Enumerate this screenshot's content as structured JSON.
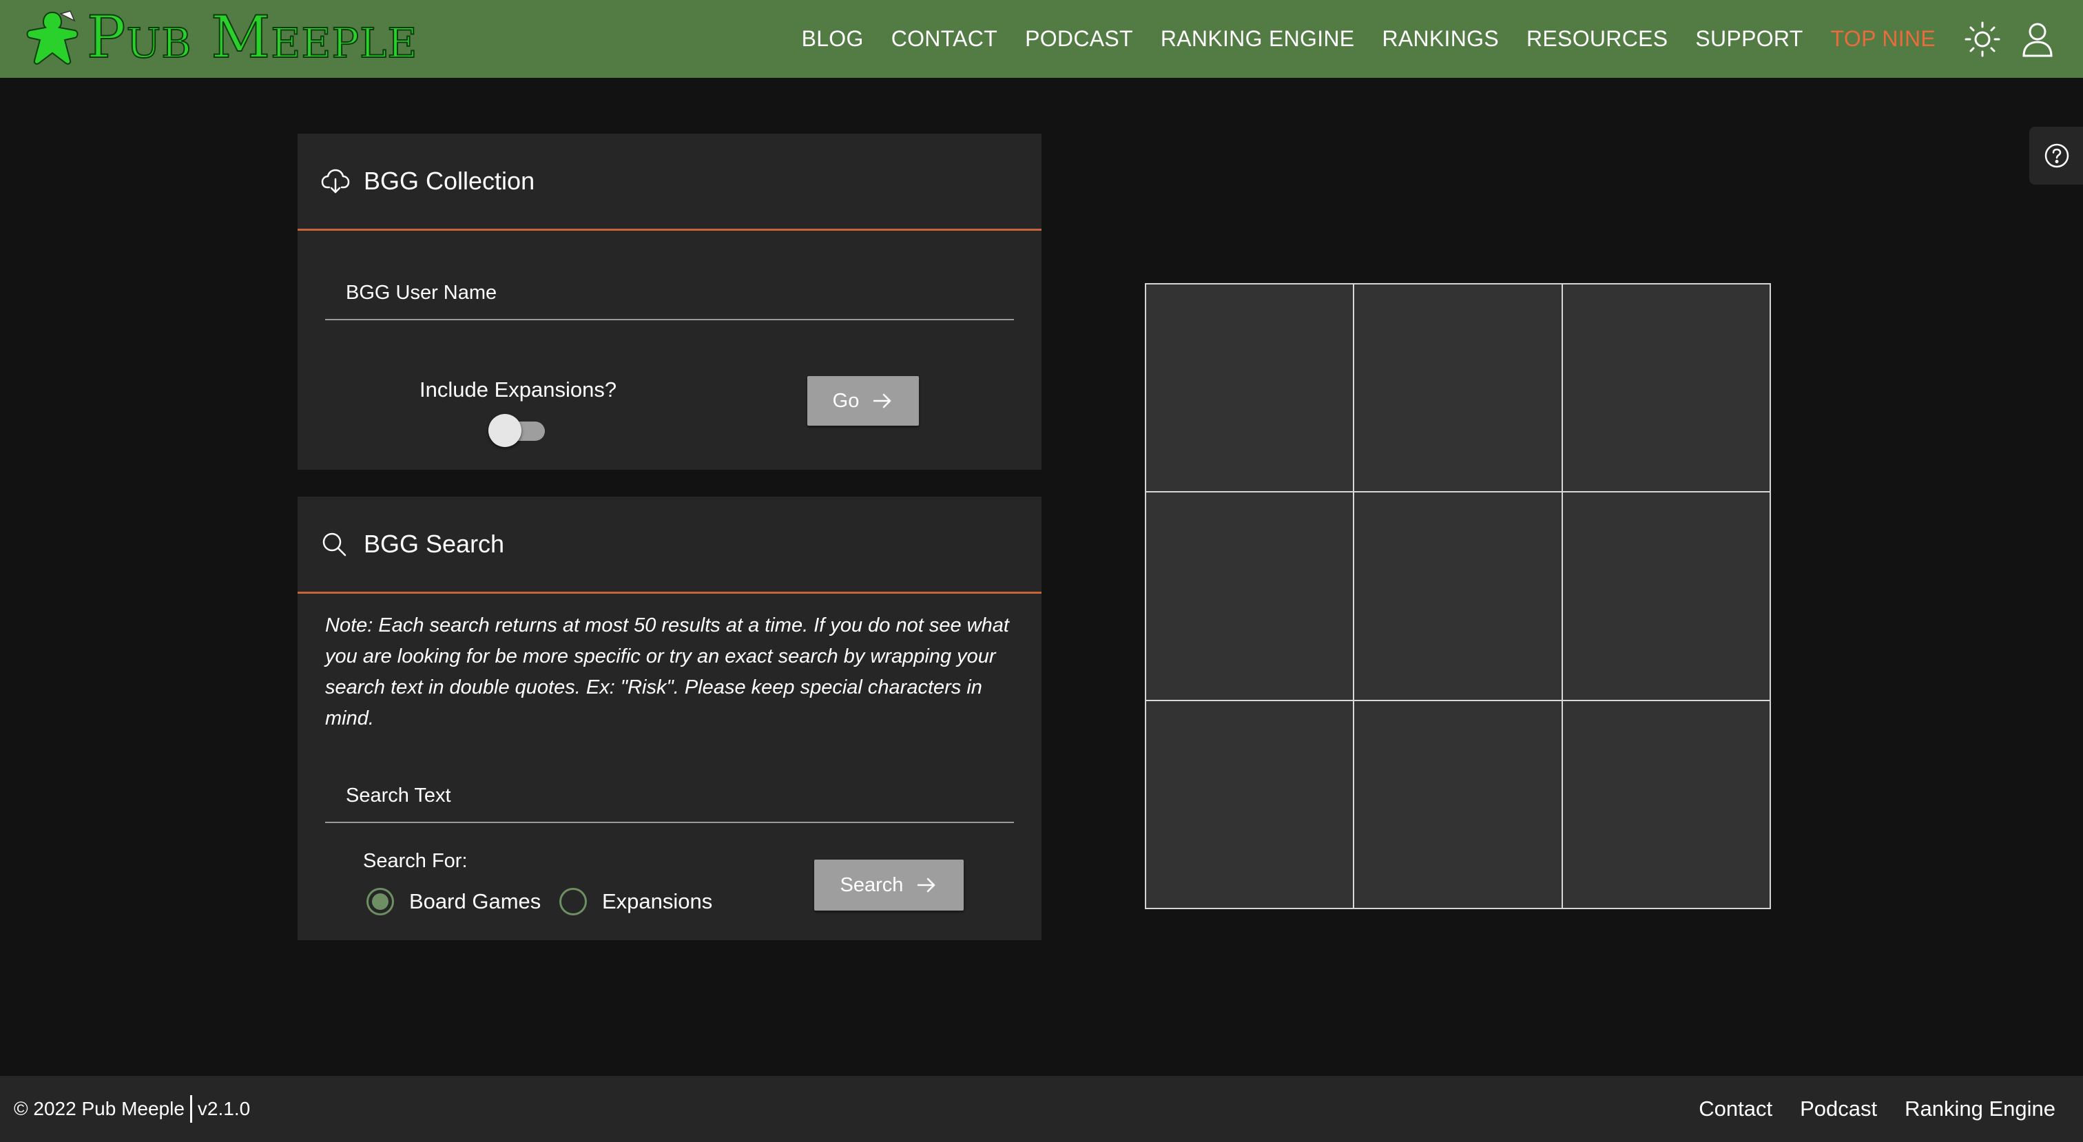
{
  "brand": {
    "name": "Pub Meeple",
    "logo_color": "#2bd12b",
    "header_bg": "#537c45"
  },
  "nav": {
    "links": [
      {
        "label": "BLOG"
      },
      {
        "label": "CONTACT"
      },
      {
        "label": "PODCAST"
      },
      {
        "label": "RANKING ENGINE"
      },
      {
        "label": "RANKINGS"
      },
      {
        "label": "RESOURCES"
      },
      {
        "label": "SUPPORT"
      },
      {
        "label": "TOP NINE",
        "active": true
      }
    ],
    "active_color": "#ea6b3b",
    "icons": [
      "sun-icon",
      "user-icon"
    ]
  },
  "help": {
    "icon": "question-circle-icon"
  },
  "collection": {
    "title": "BGG Collection",
    "icon": "cloud-download-icon",
    "username_placeholder": "BGG User Name",
    "username_value": "",
    "toggle_label": "Include Expansions?",
    "include_expansions": false,
    "go_label": "Go"
  },
  "search": {
    "title": "BGG Search",
    "icon": "search-icon",
    "note": "Note: Each search returns at most 50 results at a time. If you do not see what you are looking for be more specific or try an exact search by wrapping your search text in double quotes. Ex: \"Risk\". Please keep special characters in mind.",
    "search_placeholder": "Search Text",
    "search_value": "",
    "search_for_label": "Search For:",
    "options": [
      {
        "label": "Board Games",
        "selected": true
      },
      {
        "label": "Expansions",
        "selected": false
      }
    ],
    "search_button_label": "Search",
    "accent_color": "#c8643a"
  },
  "top_nine": {
    "cells": 9,
    "rows": 3,
    "cols": 3
  },
  "footer": {
    "copyright": "© 2022 Pub Meeple",
    "version": "v2.1.0",
    "links": [
      {
        "label": "Contact"
      },
      {
        "label": "Podcast"
      },
      {
        "label": "Ranking Engine"
      }
    ]
  }
}
